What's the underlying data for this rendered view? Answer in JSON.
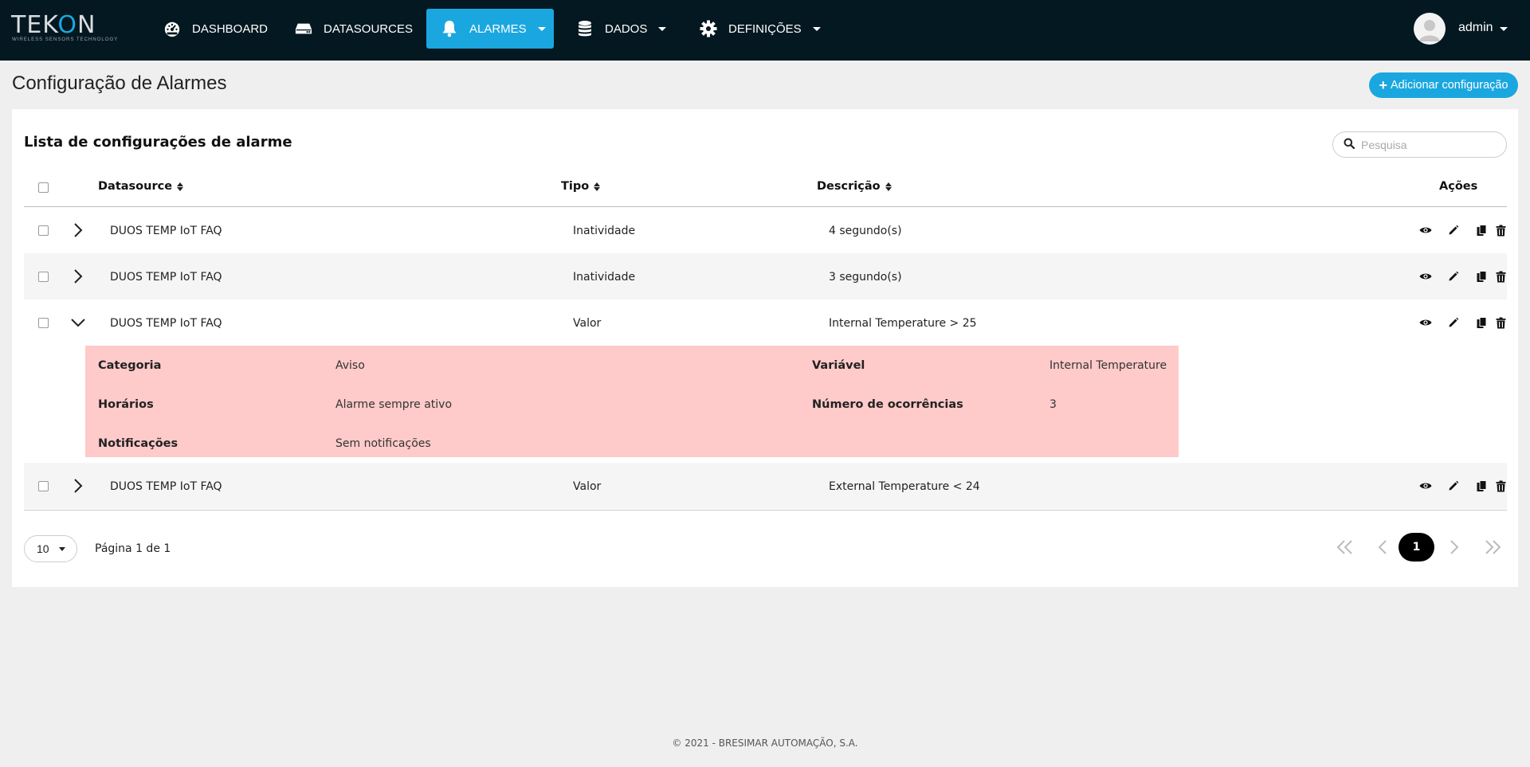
{
  "brand": {
    "logo_text": "TEKON",
    "tagline": "WIRELESS SENSORS TECHNOLOGY"
  },
  "nav": {
    "items": [
      {
        "label": "DASHBOARD",
        "icon": "speedometer-icon"
      },
      {
        "label": "DATASOURCES",
        "icon": "hard-drive-icon"
      },
      {
        "label": "ALARMES",
        "icon": "bell-icon",
        "active": true
      },
      {
        "label": "DADOS",
        "icon": "database-icon"
      },
      {
        "label": "DEFINIÇÕES",
        "icon": "gear-icon"
      }
    ],
    "user": "admin"
  },
  "page": {
    "title": "Configuração de Alarmes",
    "add_button": "Adicionar configuração"
  },
  "card": {
    "title": "Lista de configurações de alarme",
    "search_placeholder": "Pesquisa"
  },
  "table": {
    "columns": [
      "Datasource",
      "Tipo",
      "Descrição",
      "Ações"
    ],
    "rows": [
      {
        "datasource": "DUOS TEMP IoT FAQ",
        "tipo": "Inatividade",
        "descricao": "4 segundo(s)",
        "expanded": false
      },
      {
        "datasource": "DUOS TEMP IoT FAQ",
        "tipo": "Inatividade",
        "descricao": "3 segundo(s)",
        "expanded": false
      },
      {
        "datasource": "DUOS TEMP IoT FAQ",
        "tipo": "Valor",
        "descricao": "Internal Temperature > 25",
        "expanded": true
      },
      {
        "datasource": "DUOS TEMP IoT FAQ",
        "tipo": "Valor",
        "descricao": "External Temperature < 24",
        "expanded": false
      }
    ],
    "detail": {
      "categoria_label": "Categoria",
      "categoria_value": "Aviso",
      "horarios_label": "Horários",
      "horarios_value": "Alarme sempre ativo",
      "notificacoes_label": "Notificações",
      "notificacoes_value": "Sem notificações",
      "variavel_label": "Variável",
      "variavel_value": "Internal Temperature",
      "ocorrencias_label": "Número de ocorrências",
      "ocorrencias_value": "3"
    }
  },
  "pagination": {
    "page_size": "10",
    "info": "Página 1 de 1",
    "current": "1"
  },
  "footer": "© 2021 - BRESIMAR AUTOMAÇÃO, S.A.",
  "colors": {
    "navbar": "#031820",
    "accent": "#1aa7df",
    "detail_bg": "#ffcaca"
  }
}
